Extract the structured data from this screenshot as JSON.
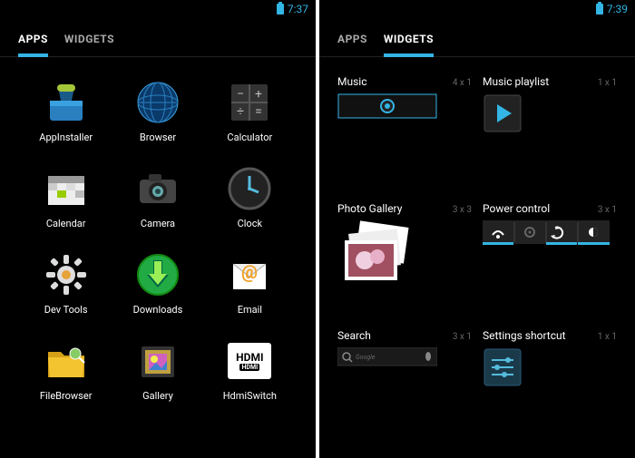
{
  "left": {
    "status": {
      "time": "7:37"
    },
    "tabs": {
      "apps": "APPS",
      "widgets": "WIDGETS",
      "active": "apps"
    },
    "apps": [
      {
        "id": "appinstaller",
        "label": "AppInstaller"
      },
      {
        "id": "browser",
        "label": "Browser"
      },
      {
        "id": "calculator",
        "label": "Calculator"
      },
      {
        "id": "calendar",
        "label": "Calendar"
      },
      {
        "id": "camera",
        "label": "Camera"
      },
      {
        "id": "clock",
        "label": "Clock"
      },
      {
        "id": "devtools",
        "label": "Dev Tools"
      },
      {
        "id": "downloads",
        "label": "Downloads"
      },
      {
        "id": "email",
        "label": "Email"
      },
      {
        "id": "filebrowser",
        "label": "FileBrowser"
      },
      {
        "id": "gallery",
        "label": "Gallery"
      },
      {
        "id": "hdmiswitch",
        "label": "HdmiSwitch"
      }
    ]
  },
  "right": {
    "status": {
      "time": "7:39"
    },
    "tabs": {
      "apps": "APPS",
      "widgets": "WIDGETS",
      "active": "widgets"
    },
    "widgets": [
      {
        "id": "music",
        "name": "Music",
        "dim": "4 x 1"
      },
      {
        "id": "music-playlist",
        "name": "Music playlist",
        "dim": "1 x 1"
      },
      {
        "id": "photo-gallery",
        "name": "Photo Gallery",
        "dim": "3 x 3"
      },
      {
        "id": "power-control",
        "name": "Power control",
        "dim": "3 x 1"
      },
      {
        "id": "search",
        "name": "Search",
        "dim": "3 x 1"
      },
      {
        "id": "settings-shortcut",
        "name": "Settings shortcut",
        "dim": "1 x 1"
      }
    ]
  }
}
